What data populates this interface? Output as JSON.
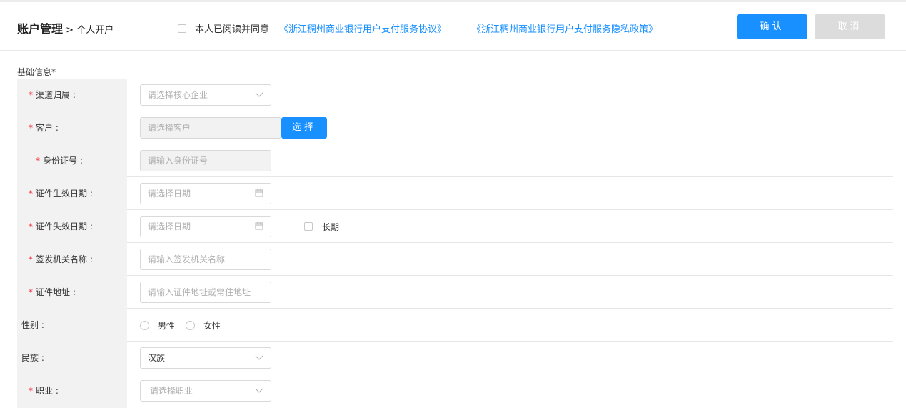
{
  "header": {
    "title_main": "账户管理",
    "title_sep": " > ",
    "title_sub": "个人开户",
    "agree_text": "本人已阅读并同意",
    "agreement_link": "《浙江稠州商业银行用户支付服务协议》",
    "privacy_link": "《浙江稠州商业银行用户支付服务隐私政策》",
    "confirm_label": "确认",
    "cancel_label": "取消"
  },
  "section": {
    "title": "基础信息*"
  },
  "form": {
    "required_mark": "*",
    "channel": {
      "label": "渠道归属 :",
      "placeholder": "请选择核心企业"
    },
    "customer": {
      "label": "客户 :",
      "placeholder": "请选择客户",
      "button": "选择"
    },
    "id_number": {
      "label": "身份证号 :",
      "placeholder": "请输入身份证号"
    },
    "id_start_date": {
      "label": "证件生效日期 :",
      "placeholder": "请选择日期"
    },
    "id_end_date": {
      "label": "证件失效日期 :",
      "placeholder": "请选择日期",
      "longterm": "长期"
    },
    "issuer": {
      "label": "签发机关名称 :",
      "placeholder": "请输入签发机关名称"
    },
    "address": {
      "label": "证件地址 :",
      "placeholder": "请输入证件地址或常住地址"
    },
    "gender": {
      "label": "性别 :",
      "male": "男性",
      "female": "女性"
    },
    "ethnicity": {
      "label": "民族 :",
      "value": "汉族"
    },
    "occupation": {
      "label": "职业 :",
      "placeholder": "请选择职业"
    }
  },
  "colors": {
    "primary": "#1890ff",
    "required": "#f5222d",
    "disabled": "#dcdcdc"
  },
  "icons": {
    "dropdown": "chevron-down-icon",
    "date": "calendar-icon"
  }
}
